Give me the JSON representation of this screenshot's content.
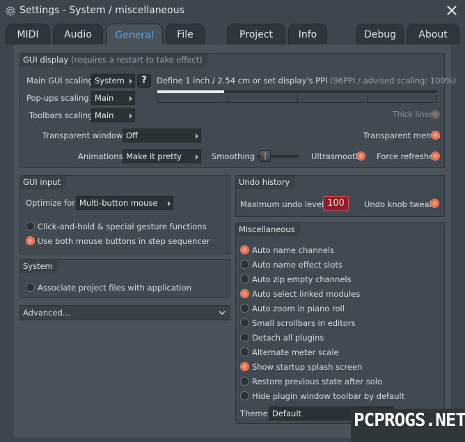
{
  "window": {
    "title": "Settings - System / miscellaneous"
  },
  "tabs": [
    {
      "label": "MIDI"
    },
    {
      "label": "Audio"
    },
    {
      "label": "General"
    },
    {
      "label": "File"
    },
    {
      "label": "Project"
    },
    {
      "label": "Info"
    },
    {
      "label": "Debug"
    },
    {
      "label": "About"
    }
  ],
  "gui_display": {
    "title": "GUI display",
    "note": "(requires a restart to take effect)",
    "main_scaling_label": "Main GUI scaling",
    "main_scaling_value": "System",
    "popups_scaling_label": "Pop-ups scaling",
    "popups_scaling_value": "Main",
    "toolbars_scaling_label": "Toolbars scaling",
    "toolbars_scaling_value": "Main",
    "help_glyph": "?",
    "ppi_text": "Define 1 inch / 2.54 cm or set display's PPI",
    "ppi_note": "(96PPI / advised scaling: 100%)",
    "ppi_slider_fraction": 0.24,
    "thick_lines": "Thick lines",
    "transparent_windows_label": "Transparent windows",
    "transparent_windows_value": "Off",
    "transparent_menus": "Transparent menus",
    "animations_label": "Animations",
    "animations_value": "Make it pretty",
    "smoothing": "Smoothing",
    "ultrasmooth": "Ultrasmooth",
    "force_refreshes": "Force refreshes"
  },
  "gui_input": {
    "title": "GUI input",
    "optimize_label": "Optimize for",
    "optimize_value": "Multi-button mouse",
    "opt1": "Click-and-hold & special gesture functions",
    "opt2": "Use both mouse buttons in step sequencer"
  },
  "system": {
    "title": "System",
    "associate": "Associate project files with application"
  },
  "advanced": {
    "label": "Advanced..."
  },
  "undo": {
    "title": "Undo history",
    "max_label": "Maximum undo levels",
    "max_value": "100",
    "knob_tweaks": "Undo knob tweaks"
  },
  "misc": {
    "title": "Miscellaneous",
    "items": [
      {
        "label": "Auto name channels",
        "on": true
      },
      {
        "label": "Auto name effect slots",
        "on": false
      },
      {
        "label": "Auto zip empty channels",
        "on": false
      },
      {
        "label": "Auto select linked modules",
        "on": true
      },
      {
        "label": "Auto zoom in piano roll",
        "on": false
      },
      {
        "label": "Small scrollbars in editors",
        "on": false
      },
      {
        "label": "Detach all plugins",
        "on": false
      },
      {
        "label": "Alternate meter scale",
        "on": false
      },
      {
        "label": "Show startup splash screen",
        "on": true
      },
      {
        "label": "Restore previous state after solo",
        "on": false
      },
      {
        "label": "Hide plugin window toolbar by default",
        "on": false
      }
    ],
    "theme_label": "Theme",
    "theme_value": "Default"
  },
  "watermark": "PCPROGS.NET",
  "colors": {
    "accent_tab": "#4ea7ee",
    "radio_on": "#f06a4a",
    "undo_box": "#8c1f27"
  }
}
